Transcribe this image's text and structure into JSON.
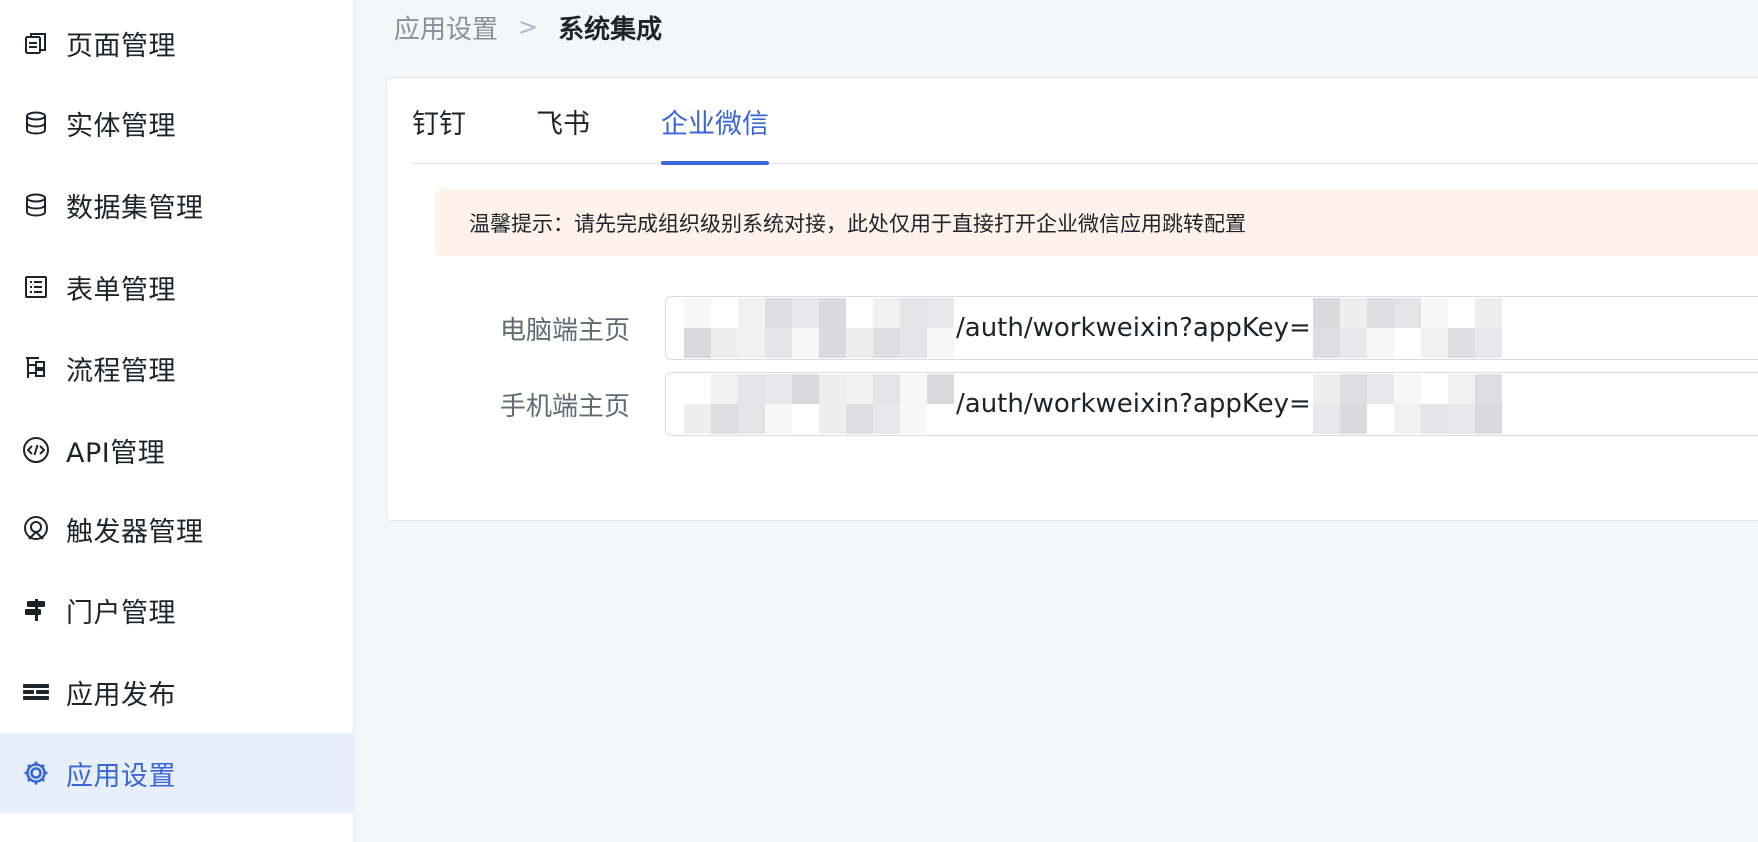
{
  "sidebar": {
    "items": [
      {
        "label": "页面管理",
        "icon": "pages-icon"
      },
      {
        "label": "实体管理",
        "icon": "database-icon"
      },
      {
        "label": "数据集管理",
        "icon": "dataset-icon"
      },
      {
        "label": "表单管理",
        "icon": "form-list-icon"
      },
      {
        "label": "流程管理",
        "icon": "flow-icon"
      },
      {
        "label": "API管理",
        "icon": "api-code-icon"
      },
      {
        "label": "触发器管理",
        "icon": "trigger-icon"
      },
      {
        "label": "门户管理",
        "icon": "signpost-icon"
      },
      {
        "label": "应用发布",
        "icon": "publish-icon"
      },
      {
        "label": "应用设置",
        "icon": "gear-icon",
        "active": true
      }
    ]
  },
  "breadcrumb": {
    "parent": "应用设置",
    "separator": ">",
    "current": "系统集成"
  },
  "tabs": [
    {
      "label": "钉钉"
    },
    {
      "label": "飞书"
    },
    {
      "label": "企业微信",
      "active": true
    }
  ],
  "notice": {
    "text": "温馨提示：请先完成组织级别系统对接，此处仅用于直接打开企业微信应用跳转配置"
  },
  "form": {
    "pc_home": {
      "label": "电脑端主页",
      "value_middle": "/auth/workweixin?appKey="
    },
    "mobile_home": {
      "label": "手机端主页",
      "value_middle": "/auth/workweixin?appKey="
    }
  },
  "colors": {
    "accent": "#3a66d8",
    "active_bg": "#e8effc",
    "notice_bg": "#fdf3ea",
    "page_bg": "#f5f6f8"
  }
}
